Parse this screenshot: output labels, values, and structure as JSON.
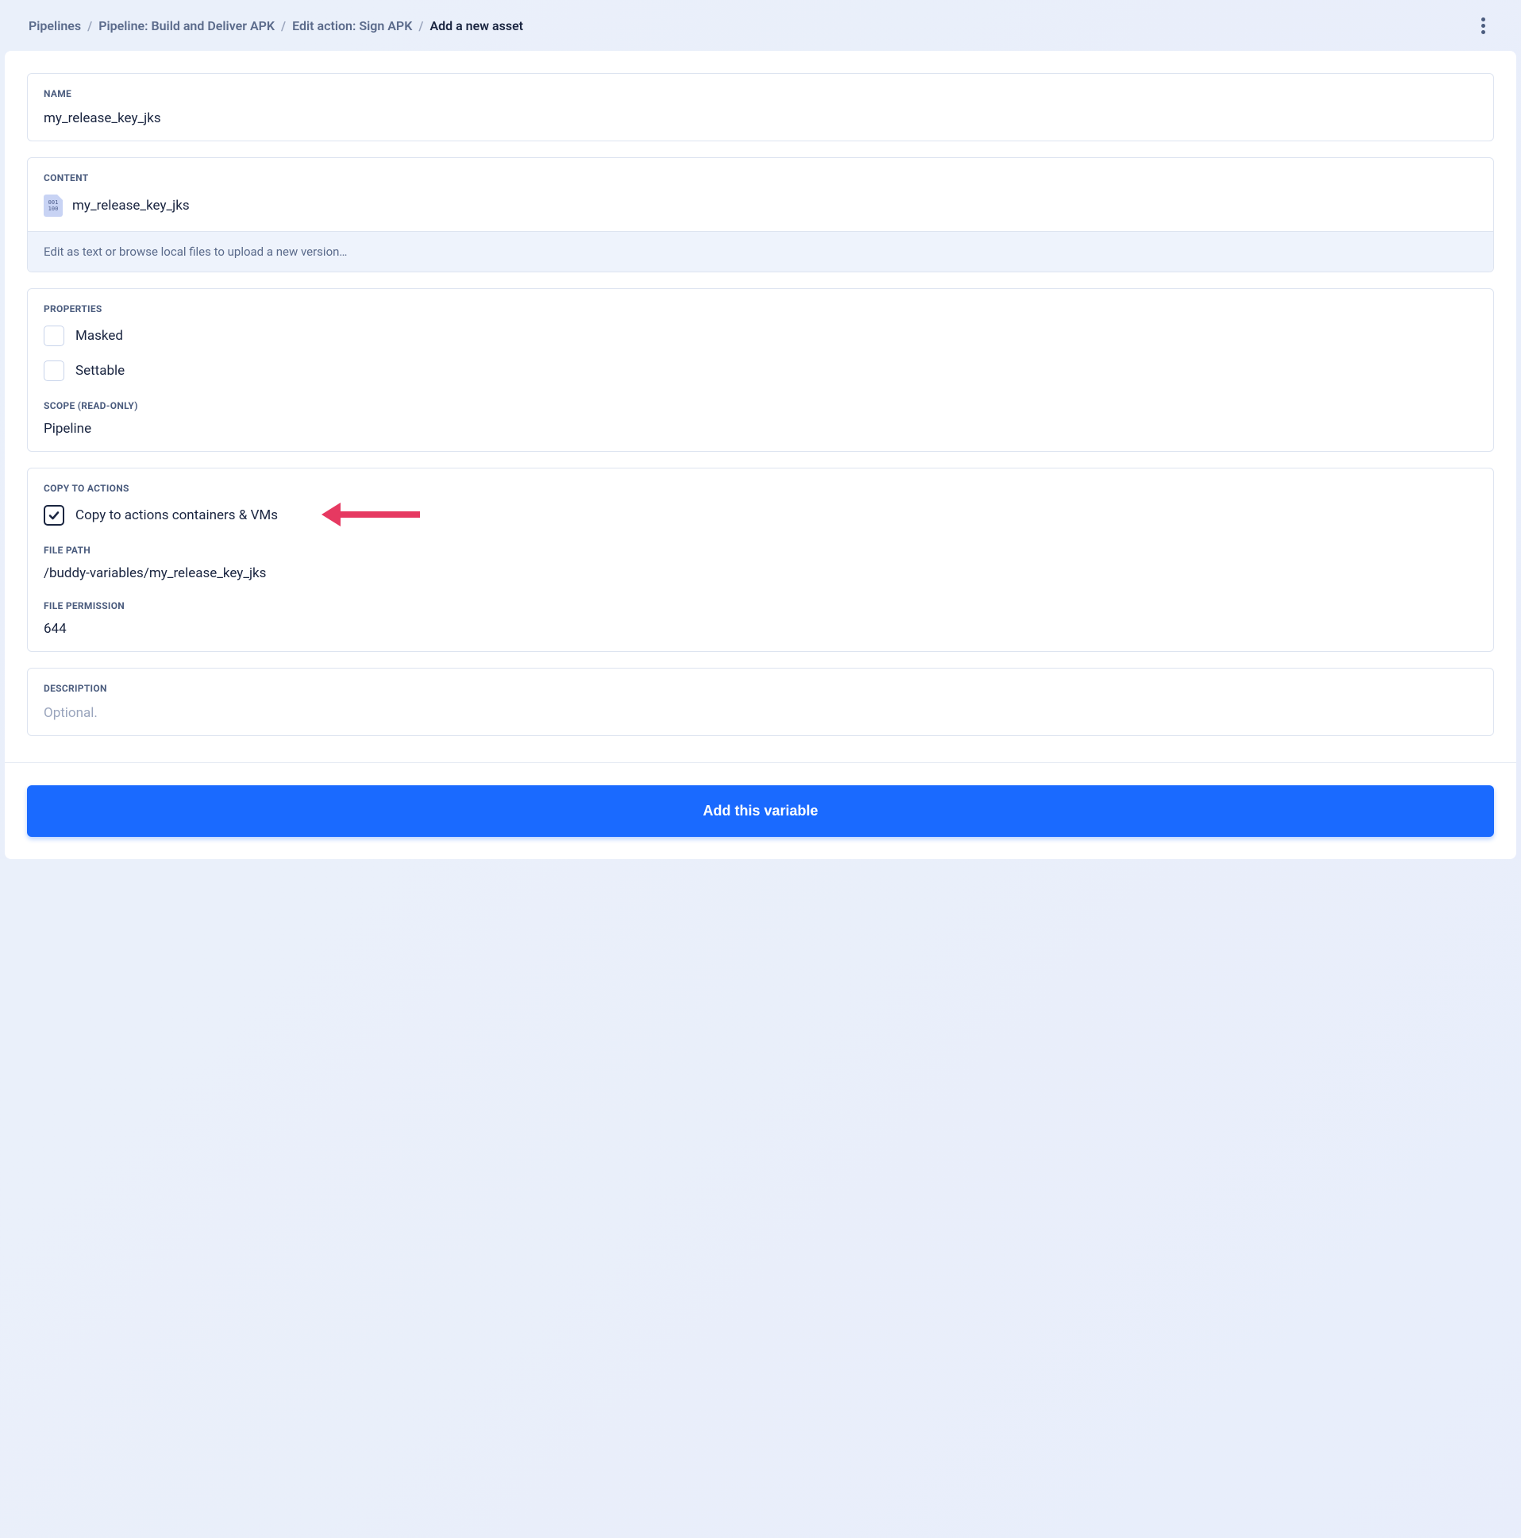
{
  "breadcrumb": {
    "items": [
      "Pipelines",
      "Pipeline: Build and Deliver APK",
      "Edit action: Sign APK"
    ],
    "current": "Add a new asset"
  },
  "name": {
    "label": "NAME",
    "value": "my_release_key_jks"
  },
  "content": {
    "label": "CONTENT",
    "filename": "my_release_key_jks",
    "hint": "Edit as text or browse local files to upload a new version…"
  },
  "properties": {
    "label": "PROPERTIES",
    "masked": {
      "label": "Masked",
      "checked": false
    },
    "settable": {
      "label": "Settable",
      "checked": false
    },
    "scope_label": "SCOPE (READ-ONLY)",
    "scope_value": "Pipeline"
  },
  "copy": {
    "label": "COPY TO ACTIONS",
    "checkbox_label": "Copy to actions containers & VMs",
    "checked": true,
    "filepath_label": "FILE PATH",
    "filepath_value": "/buddy-variables/my_release_key_jks",
    "permission_label": "FILE PERMISSION",
    "permission_value": "644"
  },
  "description": {
    "label": "DESCRIPTION",
    "placeholder": "Optional."
  },
  "button": {
    "label": "Add this variable"
  }
}
